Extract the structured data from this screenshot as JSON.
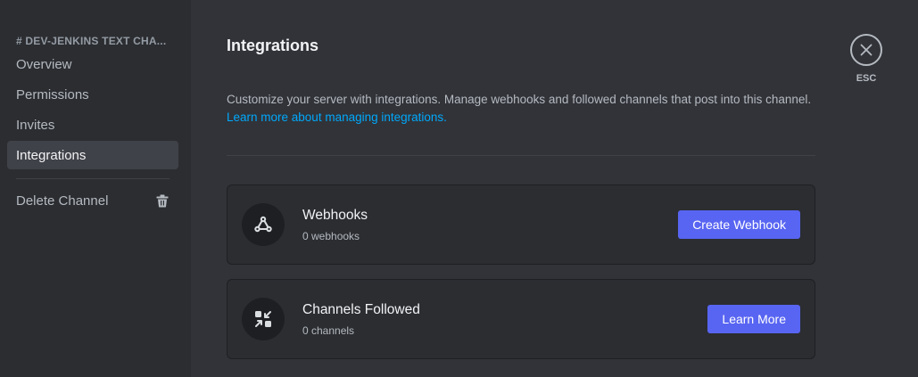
{
  "sidebar": {
    "header": "# DEV-JENKINS TEXT CHA...",
    "items": [
      {
        "label": "Overview"
      },
      {
        "label": "Permissions"
      },
      {
        "label": "Invites"
      },
      {
        "label": "Integrations"
      }
    ],
    "delete_label": "Delete Channel",
    "delete_icon": "trash-icon"
  },
  "main": {
    "title": "Integrations",
    "description": "Customize your server with integrations. Manage webhooks and followed channels that post into this channel.",
    "learn_link": "Learn more about managing integrations.",
    "cards": [
      {
        "icon": "webhook-icon",
        "title": "Webhooks",
        "subtitle": "0 webhooks",
        "button": "Create Webhook"
      },
      {
        "icon": "channels-followed-icon",
        "title": "Channels Followed",
        "subtitle": "0 channels",
        "button": "Learn More"
      }
    ]
  },
  "close": {
    "label": "ESC",
    "icon": "close-icon"
  },
  "colors": {
    "accent": "#5865f2",
    "link": "#00a8fc",
    "sidebar_bg": "#2b2d31",
    "main_bg": "#313338"
  }
}
